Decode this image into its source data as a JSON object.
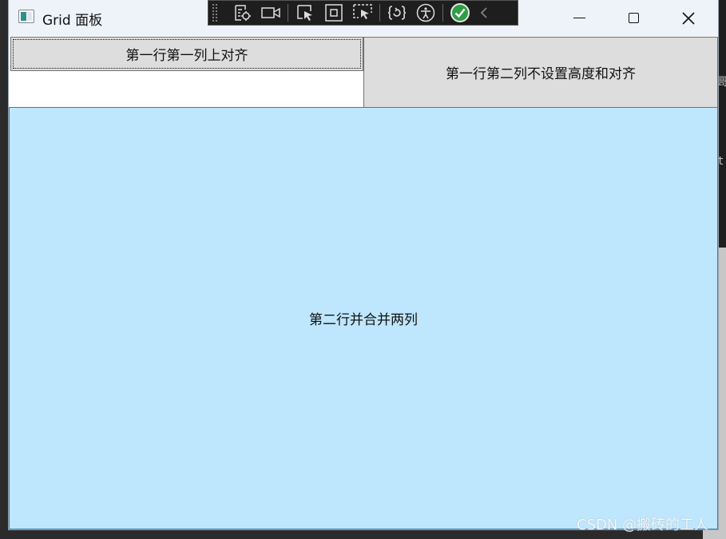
{
  "window": {
    "title": "Grid 面板"
  },
  "debug_toolbar": {
    "buttons": [
      "go-to-live-visual-tree-icon",
      "record-icon",
      "select-element-icon",
      "display-layout-adorners-icon",
      "track-focus-icon",
      "hot-reload-icon",
      "accessibility-icon",
      "binding-check-icon",
      "collapse-toolbar-icon"
    ]
  },
  "grid": {
    "row1_col1_button": "第一行第一列上对齐",
    "row1_col2_button": "第一行第二列不设置高度和对齐",
    "row2_merged_button": "第二行并合并两列"
  },
  "background": {
    "code_char_1": "哥",
    "code_char_2": "t"
  },
  "watermark": "CSDN @搬砖的工人",
  "colors": {
    "row2_background": "#bee6fd",
    "button_face": "#dddddd",
    "titlebar": "#eef2f9"
  }
}
